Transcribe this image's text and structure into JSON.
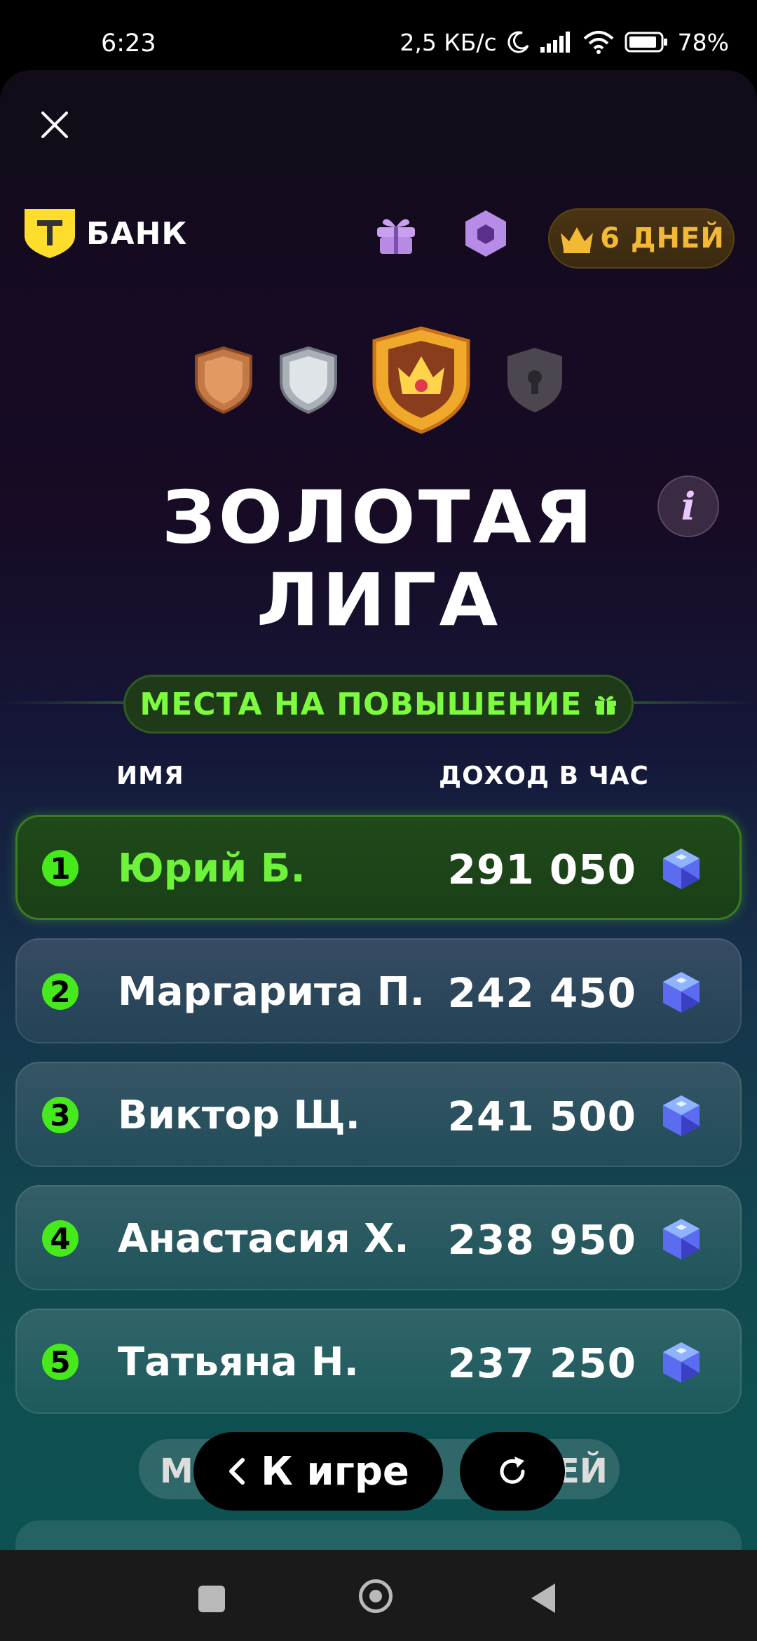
{
  "status_bar": {
    "time": "6:23",
    "network_speed": "2,5 КБ/с",
    "battery": "78%",
    "icons": [
      "moon-icon",
      "signal-icon",
      "wifi-icon",
      "battery-icon"
    ]
  },
  "header": {
    "close_icon": "close-icon",
    "logo_text": "БАНК",
    "logo_mark": "Т",
    "gift_icon": "gift-icon",
    "gem_icon": "hexagon-gem-icon",
    "days_badge": "6 ДНЕЙ"
  },
  "league": {
    "icons": [
      "bronze-shield",
      "silver-shield",
      "gold-crown-shield",
      "locked-shield"
    ],
    "title_line1": "ЗОЛОТАЯ",
    "title_line2": "ЛИГА",
    "info_label": "i"
  },
  "promotion_label": "МЕСТА НА ПОВЫШЕНИЕ",
  "columns": {
    "name": "ИМЯ",
    "income": "ДОХОД В ЧАС"
  },
  "leaderboard": [
    {
      "rank": "1",
      "name": "Юрий Б.",
      "income": "291 050"
    },
    {
      "rank": "2",
      "name": "Маргарита П.",
      "income": "242 450"
    },
    {
      "rank": "3",
      "name": "Виктор Щ.",
      "income": "241 500"
    },
    {
      "rank": "4",
      "name": "Анастасия Х.",
      "income": "238 950"
    },
    {
      "rank": "5",
      "name": "Татьяна Н.",
      "income": "237 250"
    }
  ],
  "footer": {
    "demotion_label_visible": "М",
    "demotion_label_right": "ЕЙ",
    "back_button": "К игре",
    "refresh_icon": "refresh-icon"
  },
  "colors": {
    "accent_green": "#46ea1c",
    "gold": "#f3b935"
  }
}
